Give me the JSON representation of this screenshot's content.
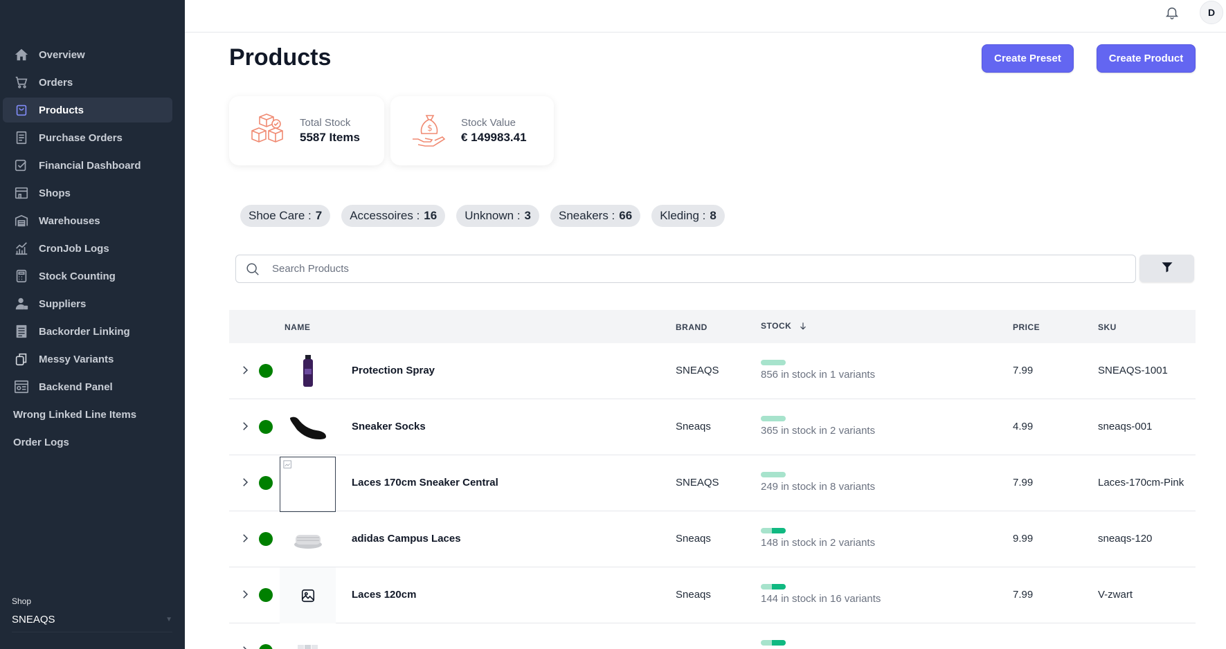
{
  "sidebar": {
    "items": [
      {
        "label": "Overview",
        "icon": "home-icon"
      },
      {
        "label": "Orders",
        "icon": "cart-icon"
      },
      {
        "label": "Products",
        "icon": "bag-icon",
        "active": true
      },
      {
        "label": "Purchase Orders",
        "icon": "receipt-icon"
      },
      {
        "label": "Financial Dashboard",
        "icon": "check-badge-icon"
      },
      {
        "label": "Shops",
        "icon": "store-icon"
      },
      {
        "label": "Warehouses",
        "icon": "warehouse-icon"
      },
      {
        "label": "CronJob Logs",
        "icon": "chart-bars-icon"
      },
      {
        "label": "Stock Counting",
        "icon": "calculator-icon"
      },
      {
        "label": "Suppliers",
        "icon": "person-icon"
      },
      {
        "label": "Backorder Linking",
        "icon": "document-list-icon"
      },
      {
        "label": "Messy Variants",
        "icon": "copy-icon"
      },
      {
        "label": "Backend Panel",
        "icon": "panel-icon"
      },
      {
        "label": "Wrong Linked Line Items"
      },
      {
        "label": "Order Logs"
      }
    ],
    "shop_label": "Shop",
    "shop_value": "SNEAQS"
  },
  "topbar": {
    "avatar_letter": "D"
  },
  "page": {
    "title": "Products",
    "create_preset": "Create Preset",
    "create_product": "Create Product"
  },
  "stats": {
    "total_stock_label": "Total Stock",
    "total_stock_value": "5587 Items",
    "stock_value_label": "Stock Value",
    "stock_value_value": "€ 149983.41"
  },
  "categories": [
    {
      "name": "Shoe Care :",
      "count": "7"
    },
    {
      "name": "Accessoires :",
      "count": "16"
    },
    {
      "name": "Unknown :",
      "count": "3"
    },
    {
      "name": "Sneakers :",
      "count": "66"
    },
    {
      "name": "Kleding :",
      "count": "8"
    }
  ],
  "search": {
    "placeholder": "Search Products"
  },
  "table": {
    "headers": {
      "name": "NAME",
      "brand": "BRAND",
      "stock": "STOCK",
      "price": "PRICE",
      "sku": "SKU"
    },
    "rows": [
      {
        "name": "Protection Spray",
        "brand": "SNEAQS",
        "stock": "856 in stock in 1 variants",
        "stock_level": 0.0,
        "price": "7.99",
        "sku": "SNEAQS-1001",
        "thumb": "spray"
      },
      {
        "name": "Sneaker Socks",
        "brand": "Sneaqs",
        "stock": "365 in stock in 2 variants",
        "stock_level": 0.0,
        "price": "4.99",
        "sku": "sneaqs-001",
        "thumb": "sock"
      },
      {
        "name": "Laces 170cm Sneaker Central",
        "brand": "SNEAQS",
        "stock": "249 in stock in 8 variants",
        "stock_level": 0.0,
        "price": "7.99",
        "sku": "Laces-170cm-Pink",
        "thumb": "broken"
      },
      {
        "name": "adidas Campus Laces",
        "brand": "Sneaqs",
        "stock": "148 in stock in 2 variants",
        "stock_level": 0.55,
        "price": "9.99",
        "sku": "sneaqs-120",
        "thumb": "laces"
      },
      {
        "name": "Laces 120cm",
        "brand": "Sneaqs",
        "stock": "144 in stock in 16 variants",
        "stock_level": 0.55,
        "price": "7.99",
        "sku": "V-zwart",
        "thumb": "placeholder"
      },
      {
        "name": "",
        "brand": "",
        "stock": "",
        "stock_level": 0.55,
        "price": "",
        "sku": "",
        "thumb": "partial"
      }
    ]
  },
  "colors": {
    "sidebar_bg": "#1f2937",
    "accent": "#6366f1",
    "status_green": "#008000",
    "stock_bar": "#10b981",
    "icon_accent": "#f08a72"
  }
}
